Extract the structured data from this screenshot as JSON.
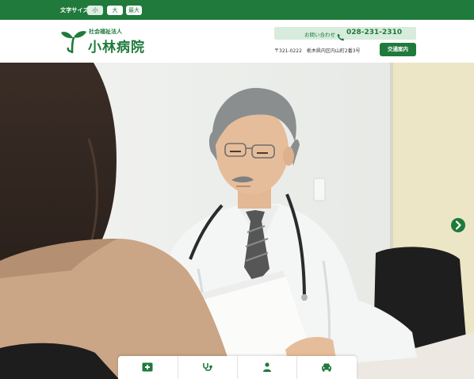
{
  "font_size": {
    "label": "文字サイズ",
    "options": [
      "小",
      "大",
      "最大"
    ],
    "selected": "小"
  },
  "logo": {
    "icon": "sprout-icon",
    "corp_type": "社会福祉法人",
    "name": "小林病院"
  },
  "contact": {
    "label": "お問い合わせ",
    "phone_icon": "phone-icon",
    "phone": "028-231-2310",
    "address": "〒321-0222　栃木県内区内山町2番3号",
    "access_button": "交通案内"
  },
  "hero": {
    "image": "doctor-consultation-photo",
    "next_icon": "chevron-right-icon"
  },
  "quick_nav": {
    "icons": [
      "hospital-icon",
      "stethoscope-icon",
      "person-icon",
      "car-icon"
    ]
  },
  "colors": {
    "brand": "#1f7a3c",
    "brand_light": "#d7ecdc"
  }
}
